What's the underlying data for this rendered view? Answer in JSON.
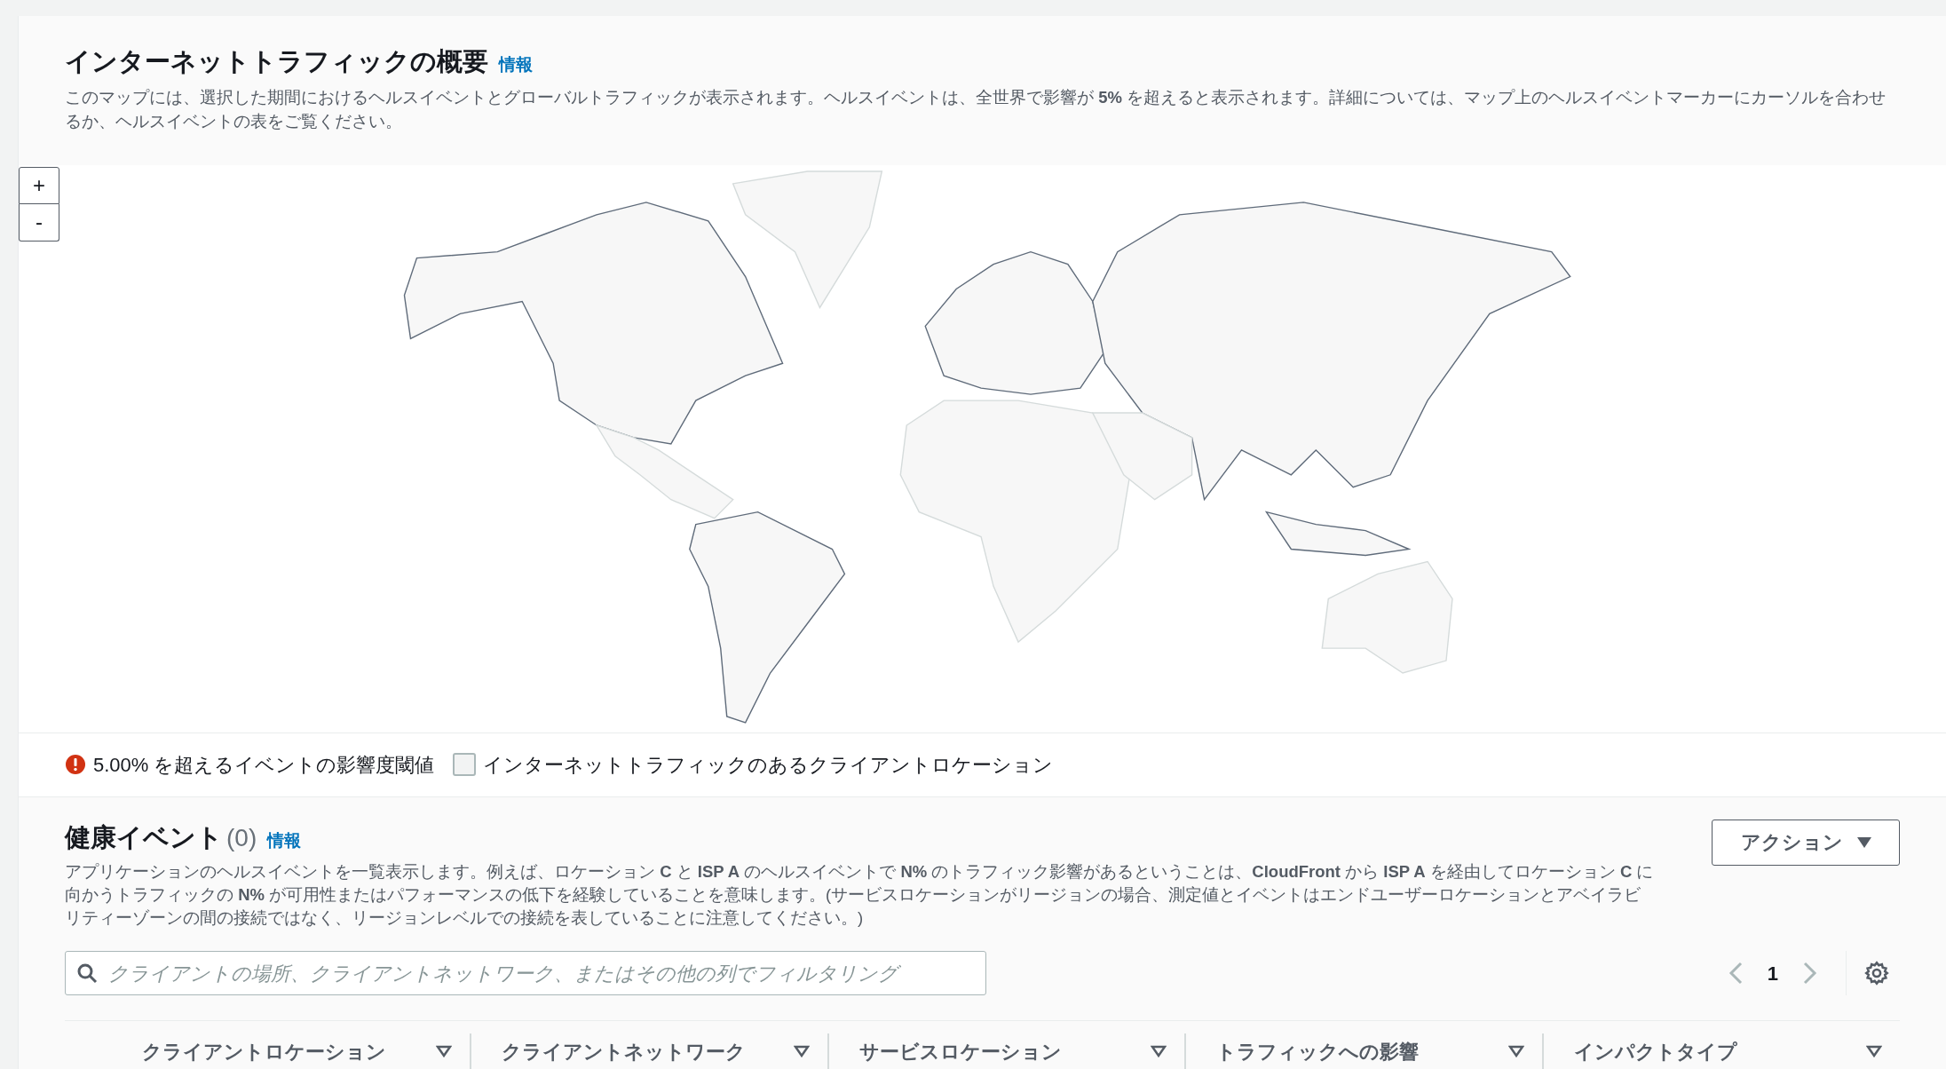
{
  "overview": {
    "title": "インターネットトラフィックの概要",
    "info_link": "情報",
    "description": "このマップには、選択した期間におけるヘルスイベントとグローバルトラフィックが表示されます。ヘルスイベントは、全世界で影響が **5%** を超えると表示されます。詳細については、マップ上のヘルスイベントマーカーにカーソルを合わせるか、ヘルスイベントの表をご覧ください。"
  },
  "map": {
    "zoom_in": "+",
    "zoom_out": "-"
  },
  "legend": [
    {
      "kind": "threshold",
      "label": "5.00% を超えるイベントの影響度閾値"
    },
    {
      "kind": "swatch",
      "label": "インターネットトラフィックのあるクライアントロケーション"
    }
  ],
  "health_events": {
    "title": "健康イベント",
    "count": "(0)",
    "info_link": "情報",
    "description": "アプリケーションのヘルスイベントを一覧表示します。例えば、ロケーション **C** と **ISP A** のヘルスイベントで **N%** のトラフィック影響があるということは、**CloudFront** から **ISP A** を経由してロケーション **C** に向かうトラフィックの **N%** が可用性またはパフォーマンスの低下を経験していることを意味します。(サービスロケーションがリージョンの場合、測定値とイベントはエンドユーザーロケーションとアベイラビリティーゾーンの間の接続ではなく、リージョンレベルでの接続を表していることに注意してください。)",
    "action_button": "アクション",
    "filter": {
      "placeholder": "クライアントの場所、クライアントネットワーク、またはその他の列でフィルタリング"
    },
    "page": "1",
    "columns": [
      "クライアントロケーション",
      "クライアントネットワーク",
      "サービスロケーション",
      "トラフィックへの影響",
      "インパクトタイプ"
    ]
  }
}
